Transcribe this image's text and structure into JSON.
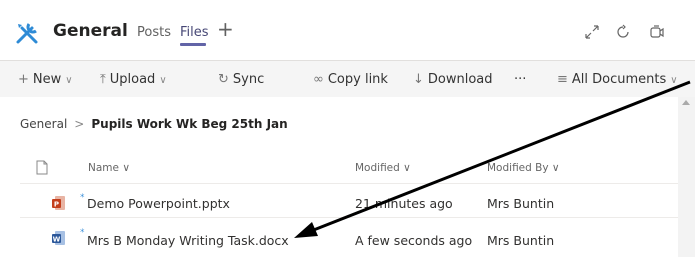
{
  "header": {
    "channel": "General",
    "tabs": [
      {
        "label": "Posts",
        "active": false
      },
      {
        "label": "Files",
        "active": true
      }
    ],
    "add_tab": "+"
  },
  "toolbar": {
    "items": [
      {
        "label": "New",
        "icon": "plus-icon",
        "chevron": true
      },
      {
        "label": "Upload",
        "icon": "upload-icon",
        "chevron": true
      },
      {
        "label": "Sync",
        "icon": "sync-icon",
        "chevron": false
      },
      {
        "label": "Copy link",
        "icon": "link-icon",
        "chevron": false
      },
      {
        "label": "Download",
        "icon": "download-icon",
        "chevron": false
      },
      {
        "label": "···",
        "icon": "",
        "chevron": false
      },
      {
        "label": "All Documents",
        "icon": "list-icon",
        "chevron": true
      }
    ]
  },
  "breadcrumb": {
    "root": "General",
    "separator": ">",
    "current": "Pupils Work Wk Beg 25th Jan"
  },
  "table": {
    "columns": [
      "Name",
      "Modified",
      "Modified By"
    ],
    "rows": [
      {
        "name": "Demo Powerpoint.pptx",
        "modified": "21 minutes ago",
        "modified_by": "Mrs Buntin",
        "type": "powerpoint",
        "icon_color": "#c43e1c"
      },
      {
        "name": "Mrs B Monday Writing Task.docx",
        "modified": "A few seconds ago",
        "modified_by": "Mrs Buntin",
        "type": "word",
        "icon_color": "#2b579a"
      }
    ]
  },
  "colors": {
    "accent": "#6264a7",
    "channel_icon": "#2e8bd6",
    "annotation_arrow": "#000000"
  }
}
